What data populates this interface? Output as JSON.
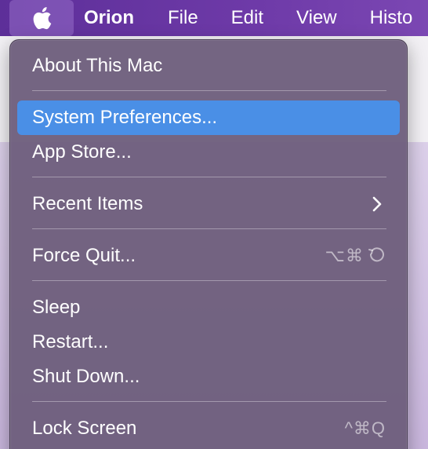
{
  "menubar": {
    "app_name": "Orion",
    "menus": [
      "File",
      "Edit",
      "View",
      "Histo"
    ]
  },
  "apple_menu": {
    "items": [
      {
        "label": "About This Mac",
        "shortcut": ""
      },
      {
        "label": "System Preferences...",
        "shortcut": ""
      },
      {
        "label": "App Store...",
        "shortcut": ""
      },
      {
        "label": "Recent Items",
        "shortcut": ""
      },
      {
        "label": "Force Quit...",
        "shortcut": "⌥⌘"
      },
      {
        "label": "Sleep",
        "shortcut": ""
      },
      {
        "label": "Restart...",
        "shortcut": ""
      },
      {
        "label": "Shut Down...",
        "shortcut": ""
      },
      {
        "label": "Lock Screen",
        "shortcut": "^⌘Q"
      }
    ],
    "highlighted_index": 1
  },
  "colors": {
    "menubar": "#6e3aa8",
    "highlight": "#4a8fe6",
    "menu_bg": "#6e5f7d"
  },
  "icons": {
    "apple": "apple-logo-icon",
    "submenu": "chevron-right-icon",
    "force_quit_extra": "escape-icon"
  }
}
